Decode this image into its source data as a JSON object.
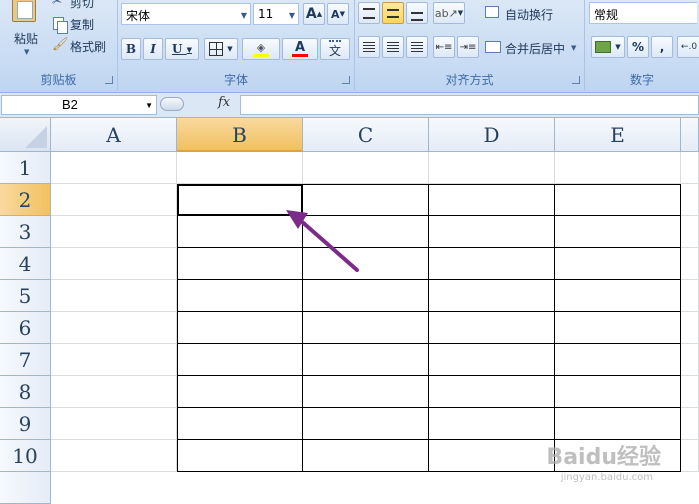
{
  "ribbon": {
    "clipboard": {
      "group_label": "剪贴板",
      "paste_label": "粘贴",
      "cut_label": "剪切",
      "copy_label": "复制",
      "format_painter_label": "格式刷"
    },
    "font": {
      "group_label": "字体",
      "font_name": "宋体",
      "font_size": "11",
      "bold": "B",
      "italic": "I",
      "underline": "U",
      "grow_font": "A",
      "shrink_font": "A",
      "font_color_glyph": "A",
      "phonetic_glyph": "文"
    },
    "alignment": {
      "group_label": "对齐方式",
      "wrap_text_label": "自动换行",
      "merge_center_label": "合并后居中"
    },
    "number": {
      "group_label": "数字",
      "format_value": "常规",
      "percent_label": "%",
      "comma_label": ","
    }
  },
  "formula_bar": {
    "name_box": "B2",
    "fx_label": "fx",
    "formula": ""
  },
  "sheet": {
    "columns": [
      "A",
      "B",
      "C",
      "D",
      "E"
    ],
    "rows": [
      "1",
      "2",
      "3",
      "4",
      "5",
      "6",
      "7",
      "8",
      "9",
      "10"
    ],
    "selected_cell": "B2",
    "selected_column": "B",
    "selected_row": "2"
  },
  "annotation": {
    "arrow_color": "#7b2b8a"
  },
  "watermark": {
    "text": "Baidu经验",
    "sub": "jingyan.baidu.com"
  },
  "colors": {
    "ribbon_bg": "#c7dbf3",
    "header_selected": "#f1c15f",
    "grid_line": "#dadcdd",
    "border_line": "#000000"
  }
}
